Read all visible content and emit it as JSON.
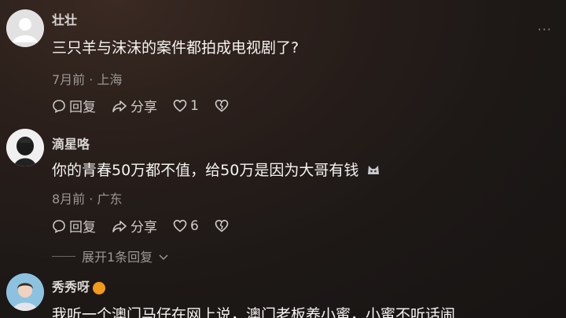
{
  "comments": [
    {
      "username": "壮壮",
      "text": "三只羊与沫沫的案件都拍成电视剧了?",
      "meta": "7月前 · 上海",
      "reply_label": "回复",
      "share_label": "分享",
      "like_count": "1"
    },
    {
      "username": "滴星咯",
      "text": "你的青春50万都不值，给50万是因为大哥有钱",
      "meta": "8月前 · 广东",
      "reply_label": "回复",
      "share_label": "分享",
      "like_count": "6"
    },
    {
      "username": "秀秀呀",
      "text": "我听一个澳门马仔在网上说，澳门老板养小蜜，小蜜不听话闹"
    }
  ],
  "expand_replies": "展开1条回复",
  "more_dots": "···",
  "colors": {
    "badge": "#f29a1a",
    "muted": "#9c9793"
  }
}
